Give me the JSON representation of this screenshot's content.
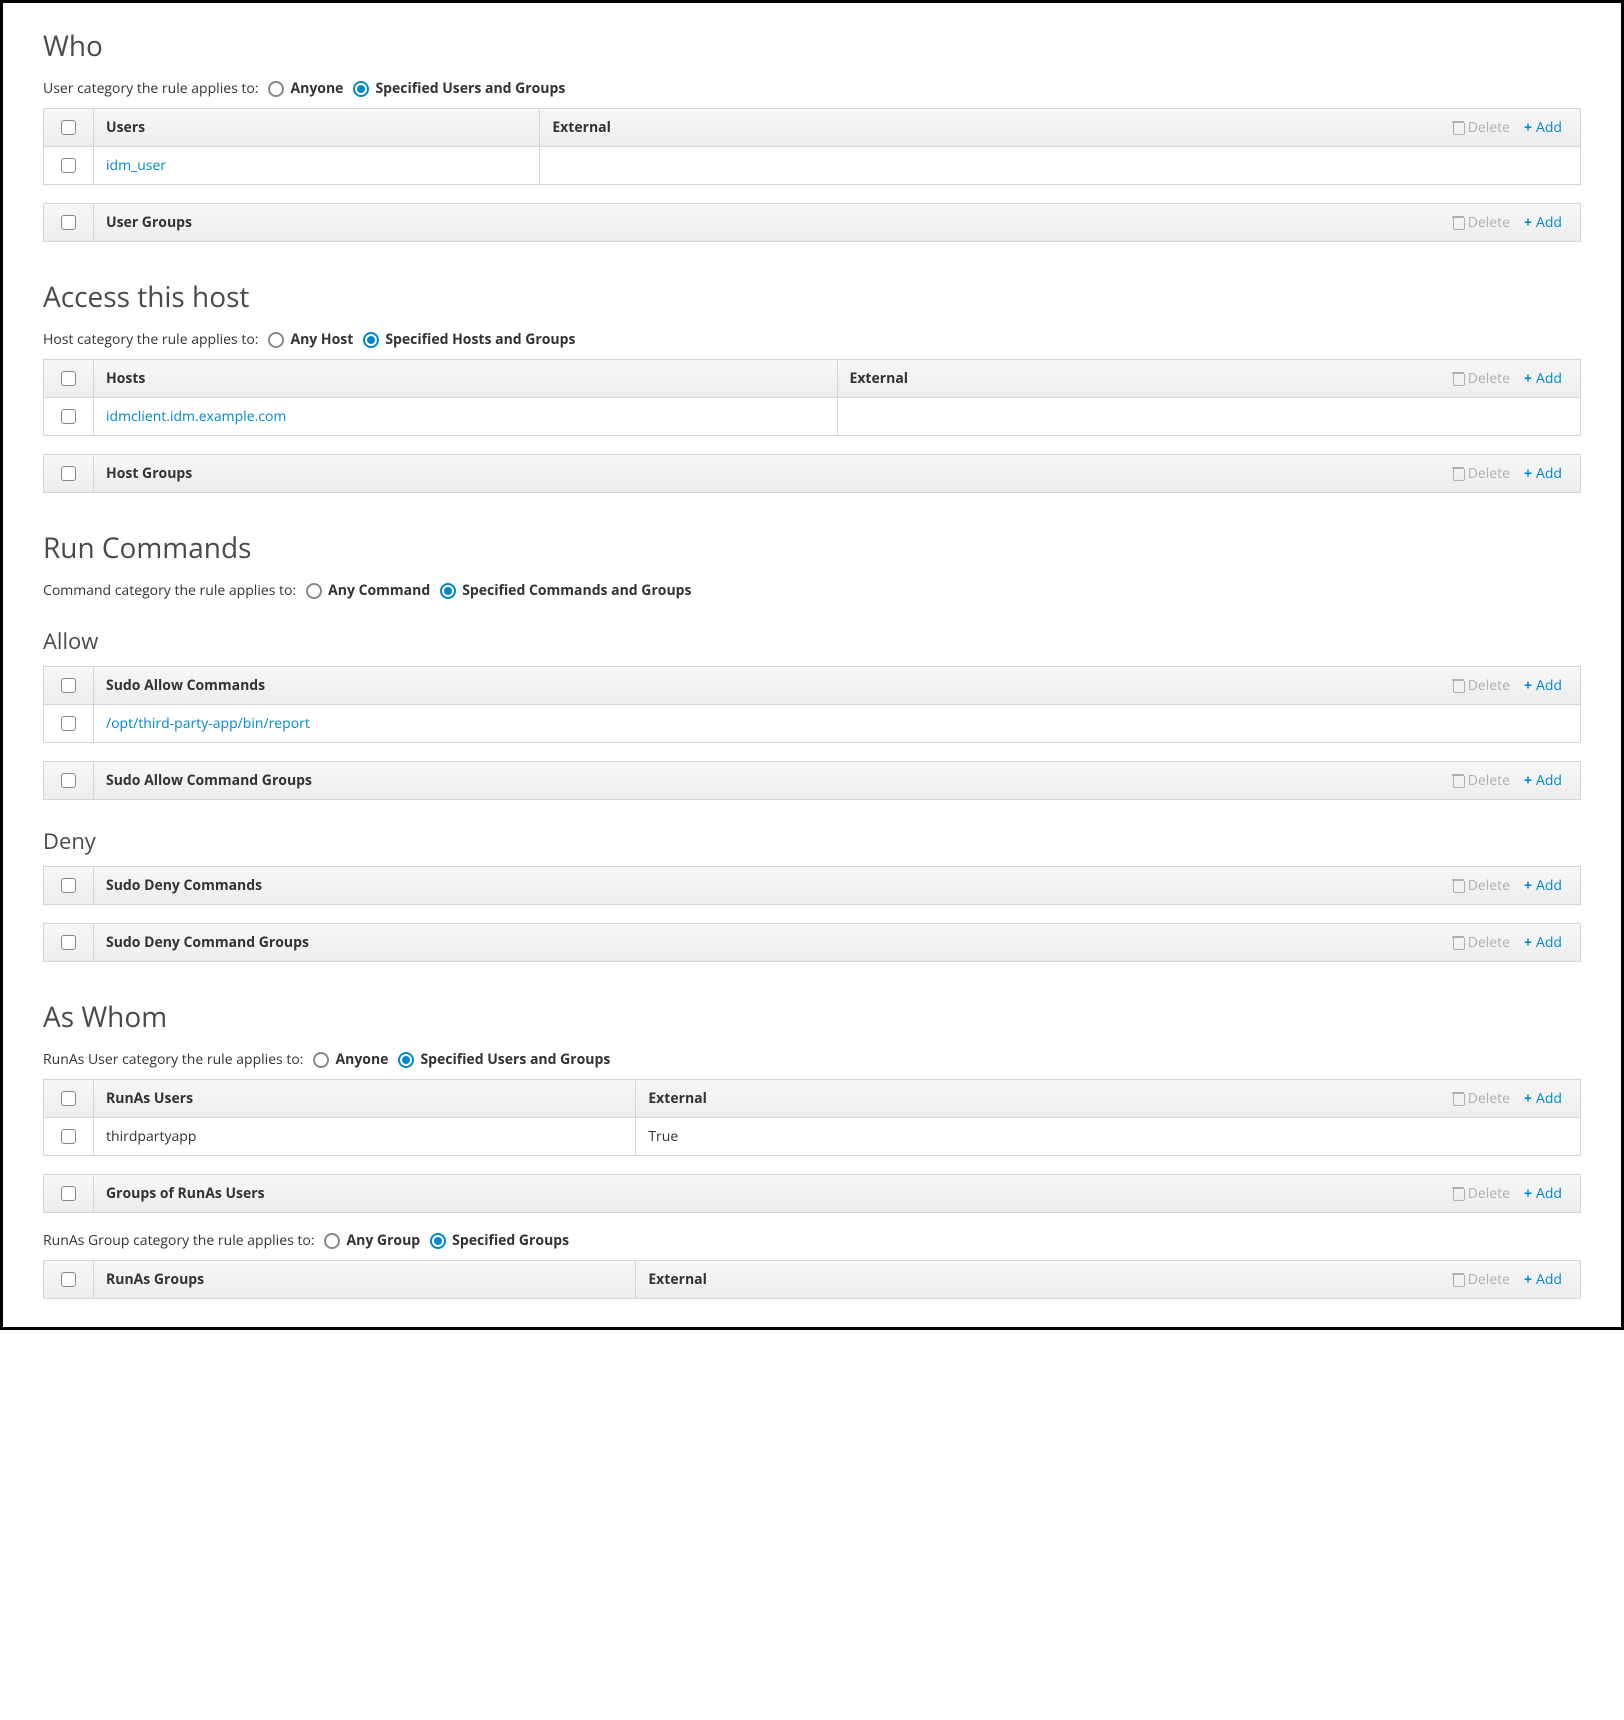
{
  "labels": {
    "delete": "Delete",
    "add": "Add"
  },
  "who": {
    "title": "Who",
    "category_label": "User category the rule applies to:",
    "option_any": "Anyone",
    "option_spec": "Specified Users and Groups",
    "users_table": {
      "col_users": "Users",
      "col_external": "External",
      "rows": [
        {
          "user": "idm_user",
          "external": ""
        }
      ]
    },
    "user_groups_table": {
      "col": "User Groups",
      "rows": []
    }
  },
  "access_host": {
    "title": "Access this host",
    "category_label": "Host category the rule applies to:",
    "option_any": "Any Host",
    "option_spec": "Specified Hosts and Groups",
    "hosts_table": {
      "col_hosts": "Hosts",
      "col_external": "External",
      "rows": [
        {
          "host": "idmclient.idm.example.com",
          "external": ""
        }
      ]
    },
    "host_groups_table": {
      "col": "Host Groups",
      "rows": []
    }
  },
  "run_commands": {
    "title": "Run Commands",
    "category_label": "Command category the rule applies to:",
    "option_any": "Any Command",
    "option_spec": "Specified Commands and Groups",
    "allow_title": "Allow",
    "deny_title": "Deny",
    "allow_cmds": {
      "col": "Sudo Allow Commands",
      "rows": [
        {
          "cmd": "/opt/third-party-app/bin/report"
        }
      ]
    },
    "allow_cmd_groups": {
      "col": "Sudo Allow Command Groups",
      "rows": []
    },
    "deny_cmds": {
      "col": "Sudo Deny Commands",
      "rows": []
    },
    "deny_cmd_groups": {
      "col": "Sudo Deny Command Groups",
      "rows": []
    }
  },
  "as_whom": {
    "title": "As Whom",
    "user_category_label": "RunAs User category the rule applies to:",
    "user_option_any": "Anyone",
    "user_option_spec": "Specified Users and Groups",
    "group_category_label": "RunAs Group category the rule applies to:",
    "group_option_any": "Any Group",
    "group_option_spec": "Specified Groups",
    "runas_users": {
      "col_users": "RunAs Users",
      "col_external": "External",
      "rows": [
        {
          "user": "thirdpartyapp",
          "external": "True"
        }
      ]
    },
    "groups_of_runas_users": {
      "col": "Groups of RunAs Users",
      "rows": []
    },
    "runas_groups": {
      "col_groups": "RunAs Groups",
      "col_external": "External",
      "rows": []
    }
  }
}
